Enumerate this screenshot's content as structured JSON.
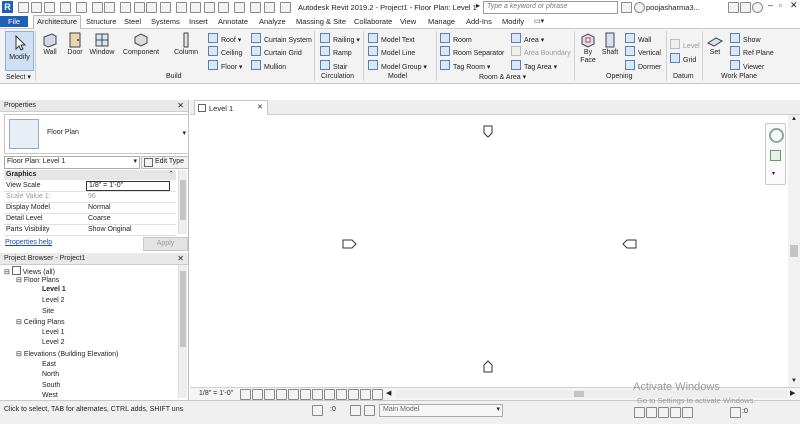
{
  "titlebar": {
    "app_title": "Autodesk Revit 2019.2 - Project1 - Floor Plan: Level 1",
    "search_placeholder": "Type a keyword or phrase",
    "username": "poojasharma3..."
  },
  "tabs": [
    "File",
    "Architecture",
    "Structure",
    "Steel",
    "Systems",
    "Insert",
    "Annotate",
    "Analyze",
    "Massing & Site",
    "Collaborate",
    "View",
    "Manage",
    "Add-Ins",
    "Modify"
  ],
  "active_tab": "Architecture",
  "ribbon": {
    "select": {
      "modify": "Modify",
      "label": "Select ▾"
    },
    "build": {
      "wall": "Wall",
      "door": "Door",
      "window": "Window",
      "component": "Component",
      "column": "Column",
      "roof": "Roof ▾",
      "ceiling": "Ceiling",
      "floor": "Floor ▾",
      "curtain_system": "Curtain System",
      "curtain_grid": "Curtain Grid",
      "mullion": "Mullion",
      "label": "Build"
    },
    "circulation": {
      "railing": "Railing ▾",
      "ramp": "Ramp",
      "stair": "Stair",
      "label": "Circulation"
    },
    "model": {
      "model_text": "Model Text",
      "model_line": "Model Line",
      "model_group": "Model Group ▾",
      "label": "Model"
    },
    "room_area": {
      "room": "Room",
      "room_separator": "Room Separator",
      "tag_room": "Tag Room ▾",
      "area": "Area ▾",
      "area_boundary": "Area Boundary",
      "tag_area": "Tag Area ▾",
      "label": "Room & Area ▾"
    },
    "opening": {
      "by_face": "By Face",
      "shaft": "Shaft",
      "wall": "Wall",
      "vertical": "Vertical",
      "dormer": "Dormer",
      "label": "Opening"
    },
    "datum": {
      "level": "Level",
      "grid": "Grid",
      "label": "Datum"
    },
    "work_plane": {
      "set": "Set",
      "show": "Show",
      "ref_plane": "Ref Plane",
      "viewer": "Viewer",
      "label": "Work Plane"
    }
  },
  "properties": {
    "title": "Properties",
    "type_name": "Floor Plan",
    "instance_selector": "Floor Plan: Level 1",
    "edit_type": "Edit Type",
    "section": "Graphics",
    "rows": [
      {
        "key": "View Scale",
        "value": "1/8\" = 1'-0\""
      },
      {
        "key": "Scale Value    1:",
        "value": "96"
      },
      {
        "key": "Display Model",
        "value": "Normal"
      },
      {
        "key": "Detail Level",
        "value": "Coarse"
      },
      {
        "key": "Parts Visibility",
        "value": "Show Original"
      }
    ],
    "help": "Properties help",
    "apply": "Apply"
  },
  "browser": {
    "title": "Project Browser - Project1",
    "root": "Views (all)",
    "floor_plans": "Floor Plans",
    "fp_items": [
      "Level 1",
      "Level 2",
      "Site"
    ],
    "ceiling_plans": "Ceiling Plans",
    "cp_items": [
      "Level 1",
      "Level 2"
    ],
    "elevations": "Elevations (Building Elevation)",
    "el_items": [
      "East",
      "North",
      "South",
      "West"
    ]
  },
  "view_tab": {
    "label": "Level 1"
  },
  "view_bar": {
    "scale": "1/8\" = 1'-0\""
  },
  "status": {
    "hint": "Click to select, TAB for alternates, CTRL adds, SHIFT uns",
    "count": ":0",
    "model": "Main Model",
    "watermark_title": "Activate Windows",
    "watermark_sub": "Go to Settings to activate Windows.",
    "filter_count": ":0"
  }
}
